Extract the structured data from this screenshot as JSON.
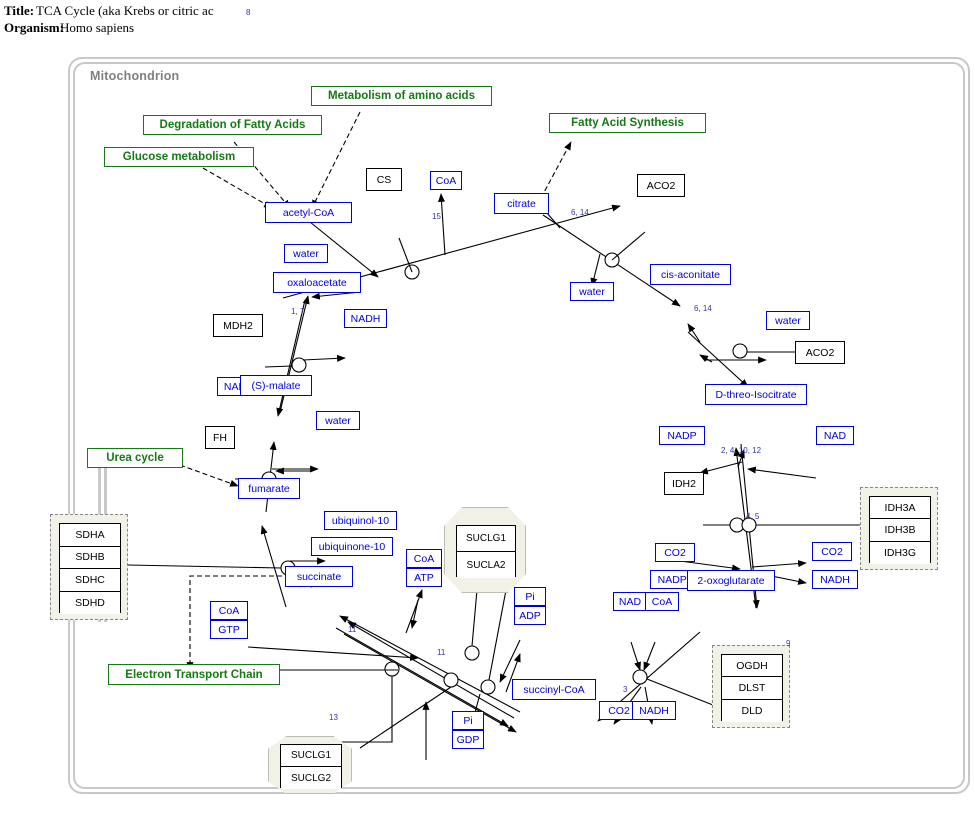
{
  "header": {
    "title_label": "Title:",
    "title_value": "TCA Cycle (aka Krebs or citric ac",
    "organism_label": "Organism:",
    "organism_value": "Homo sapiens",
    "title_marker": "8"
  },
  "compartment": {
    "label": "Mitochondrion"
  },
  "colors": {
    "metabolite": "#0000dd",
    "enzyme": "#000000",
    "pathway": "#157a15",
    "compartment_border": "#c8c8c8",
    "complex_fill": "#f2f1e8",
    "edge_label": "#3333aa"
  },
  "pathway_links": [
    {
      "id": "glucose",
      "label": "Glucose metabolism"
    },
    {
      "id": "fatty_deg",
      "label": "Degradation of Fatty Acids"
    },
    {
      "id": "amino",
      "label": "Metabolism of amino acids"
    },
    {
      "id": "fatty_syn",
      "label": "Fatty Acid Synthesis"
    },
    {
      "id": "urea",
      "label": "Urea cycle"
    },
    {
      "id": "etc",
      "label": "Electron Transport Chain"
    }
  ],
  "metabolites": [
    {
      "id": "acetyl_coa",
      "label": "acetyl-CoA"
    },
    {
      "id": "coa_1",
      "label": "CoA"
    },
    {
      "id": "citrate",
      "label": "citrate"
    },
    {
      "id": "water_1",
      "label": "water"
    },
    {
      "id": "oxaloacetate",
      "label": "oxaloacetate"
    },
    {
      "id": "water_2",
      "label": "water"
    },
    {
      "id": "cis_aconitate",
      "label": "cis-aconitate"
    },
    {
      "id": "water_3",
      "label": "water"
    },
    {
      "id": "nadh_1",
      "label": "NADH"
    },
    {
      "id": "nad_1",
      "label": "NAD"
    },
    {
      "id": "s_malate",
      "label": "(S)-malate"
    },
    {
      "id": "water_4",
      "label": "water"
    },
    {
      "id": "d_isocitrate",
      "label": "D-threo-Isocitrate"
    },
    {
      "id": "nadp",
      "label": "NADP"
    },
    {
      "id": "nad_2",
      "label": "NAD"
    },
    {
      "id": "fumarate",
      "label": "fumarate"
    },
    {
      "id": "co2_1",
      "label": "CO2"
    },
    {
      "id": "co2_2",
      "label": "CO2"
    },
    {
      "id": "nadph",
      "label": "NADPH"
    },
    {
      "id": "nadh_2",
      "label": "NADH"
    },
    {
      "id": "ubiquinol",
      "label": "ubiquinol-10"
    },
    {
      "id": "ubiquinone",
      "label": "ubiquinone-10"
    },
    {
      "id": "oxoglutarate",
      "label": "2-oxoglutarate"
    },
    {
      "id": "succinate",
      "label": "succinate"
    },
    {
      "id": "coa_2",
      "label": "CoA"
    },
    {
      "id": "atp",
      "label": "ATP"
    },
    {
      "id": "pi_1",
      "label": "Pi"
    },
    {
      "id": "adp",
      "label": "ADP"
    },
    {
      "id": "nad_3",
      "label": "NAD"
    },
    {
      "id": "coa_3",
      "label": "CoA"
    },
    {
      "id": "coa_4",
      "label": "CoA"
    },
    {
      "id": "gtp",
      "label": "GTP"
    },
    {
      "id": "succinyl_coa",
      "label": "succinyl-CoA"
    },
    {
      "id": "co2_3",
      "label": "CO2"
    },
    {
      "id": "nadh_3",
      "label": "NADH"
    },
    {
      "id": "pi_2",
      "label": "Pi"
    },
    {
      "id": "gdp",
      "label": "GDP"
    }
  ],
  "enzymes": [
    {
      "id": "cs",
      "label": "CS"
    },
    {
      "id": "aco2_1",
      "label": "ACO2"
    },
    {
      "id": "aco2_2",
      "label": "ACO2"
    },
    {
      "id": "mdh2",
      "label": "MDH2"
    },
    {
      "id": "fh",
      "label": "FH"
    },
    {
      "id": "idh2",
      "label": "IDH2"
    }
  ],
  "complexes": [
    {
      "id": "sdh",
      "shape": "dashed",
      "marker": "",
      "subunits": [
        "SDHA",
        "SDHB",
        "SDHC",
        "SDHD"
      ]
    },
    {
      "id": "idh3",
      "shape": "dashed",
      "marker": "",
      "subunits": [
        "IDH3A",
        "IDH3B",
        "IDH3G"
      ]
    },
    {
      "id": "ogdh",
      "shape": "dashed",
      "marker": "9",
      "subunits": [
        "OGDH",
        "DLST",
        "DLD"
      ]
    },
    {
      "id": "sucla",
      "shape": "octagon",
      "marker": "",
      "subunits": [
        "SUCLG1",
        "SUCLA2"
      ]
    },
    {
      "id": "suclg",
      "shape": "octagon",
      "marker": "13",
      "subunits": [
        "SUCLG1",
        "SUCLG2"
      ]
    }
  ],
  "edge_labels": [
    {
      "id": "cs_rxn",
      "text": "15"
    },
    {
      "id": "aco2_a",
      "text": "6, 14"
    },
    {
      "id": "aco2_b",
      "text": "6, 14"
    },
    {
      "id": "mdh_rxn",
      "text": "1, 7"
    },
    {
      "id": "idh_upper",
      "text": "2, 4, 10, 12"
    },
    {
      "id": "idh_lower",
      "text": "4, 5"
    },
    {
      "id": "ogdh_rxn",
      "text": "3"
    },
    {
      "id": "scs_a",
      "text": "11"
    },
    {
      "id": "scs_b",
      "text": "11"
    }
  ]
}
